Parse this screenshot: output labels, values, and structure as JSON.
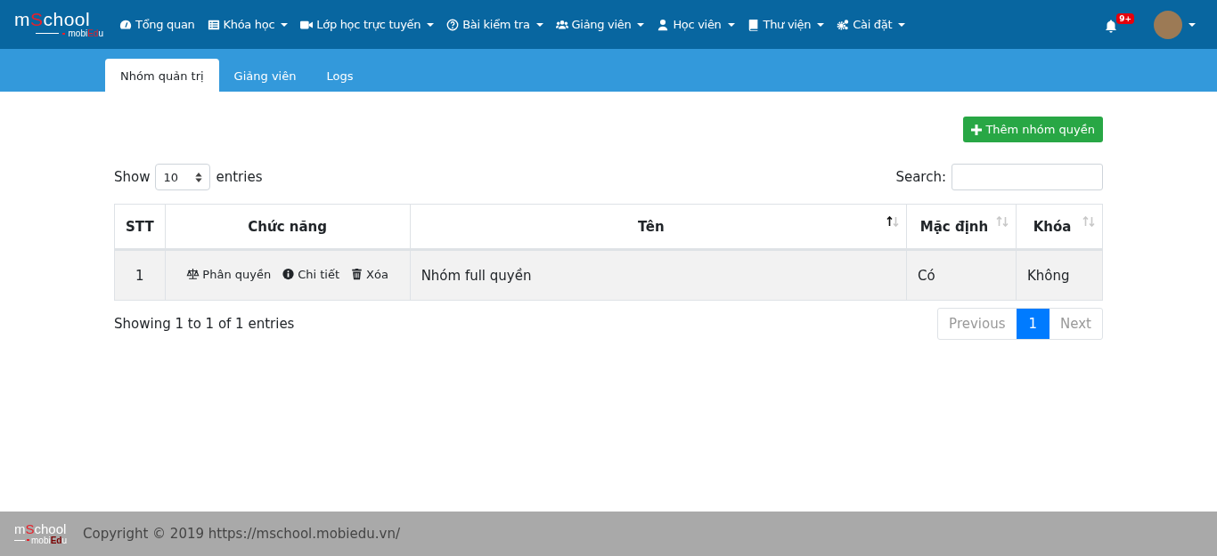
{
  "logo": {
    "name_start": "m",
    "name_accent": "S",
    "name_end": "chool",
    "sub_start": "mobi",
    "sub_accent": "Ed",
    "sub_end": "u"
  },
  "nav": [
    {
      "label": "Tổng quan",
      "dropdown": false
    },
    {
      "label": "Khóa học",
      "dropdown": true
    },
    {
      "label": "Lớp học trực tuyến",
      "dropdown": true
    },
    {
      "label": "Bài kiểm tra",
      "dropdown": true
    },
    {
      "label": "Giảng viên",
      "dropdown": true
    },
    {
      "label": "Học viên",
      "dropdown": true
    },
    {
      "label": "Thư viện",
      "dropdown": true
    },
    {
      "label": "Cài đặt",
      "dropdown": true
    }
  ],
  "notifications": {
    "badge": "9+"
  },
  "tabs": [
    {
      "label": "Nhóm quản trị",
      "selected": true
    },
    {
      "label": "Giảng viên",
      "selected": false
    },
    {
      "label": "Logs",
      "selected": false
    }
  ],
  "add_button": "Thêm nhóm quyền",
  "length": {
    "before": "Show",
    "value": "10",
    "after": "entries"
  },
  "search": {
    "label": "Search:"
  },
  "table": {
    "columns": [
      {
        "label": "STT",
        "sortable": false
      },
      {
        "label": "Chức năng",
        "sortable": false
      },
      {
        "label": "Tên",
        "sortable": true,
        "sorted": true
      },
      {
        "label": "Mặc định",
        "sortable": true,
        "sorted": false
      },
      {
        "label": "Khóa",
        "sortable": true,
        "sorted": false
      }
    ],
    "rows": [
      {
        "stt": "1",
        "actions": [
          {
            "label": "Phân quyền"
          },
          {
            "label": "Chi tiết"
          },
          {
            "label": "Xóa"
          }
        ],
        "name": "Nhóm full quyền",
        "default": "Có",
        "locked": "Không"
      }
    ]
  },
  "info": "Showing 1 to 1 of 1 entries",
  "pagination": [
    {
      "label": "Previous",
      "selected": false,
      "disabled": true
    },
    {
      "label": "1",
      "selected": true,
      "disabled": false
    },
    {
      "label": "Next",
      "selected": false,
      "disabled": true
    }
  ],
  "footer": {
    "logo": {
      "name_start": "m",
      "name_accent": "S",
      "name_end": "chool",
      "sub_start": "mobi",
      "sub_accent": "Ed",
      "sub_end": "u"
    },
    "copyright": "Copyright © 2019 https://mschool.mobiedu.vn/"
  }
}
